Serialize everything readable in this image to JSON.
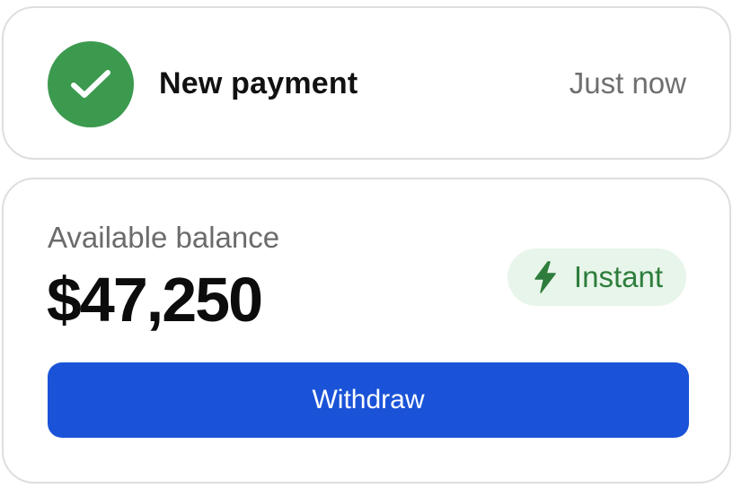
{
  "notification": {
    "title": "New payment",
    "time": "Just now",
    "icon": "check-icon",
    "icon_color": "#3c9a4f"
  },
  "balance": {
    "label": "Available balance",
    "amount": "$47,250",
    "badge": {
      "label": "Instant",
      "icon": "lightning-icon",
      "text_color": "#2e7d3c",
      "background": "#e8f5ea"
    },
    "withdraw_label": "Withdraw",
    "button_color": "#1a53d8"
  }
}
